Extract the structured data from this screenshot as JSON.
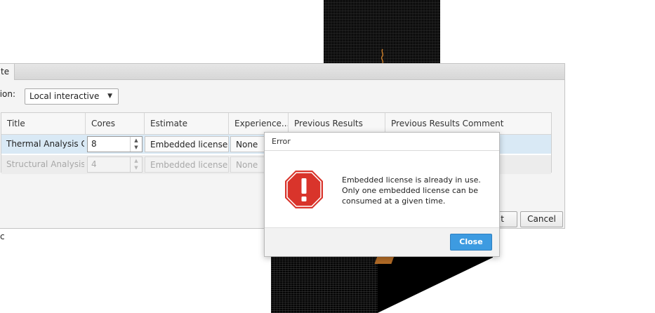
{
  "tab": {
    "label": "te"
  },
  "configuration": {
    "label": "tion:",
    "value": "Local interactive"
  },
  "grid": {
    "columns": [
      "Title",
      "Cores",
      "Estimate",
      "Experience...",
      "Previous Results",
      "Previous Results Comment"
    ],
    "rows": [
      {
        "title": "Thermal Analysis C...",
        "cores": "8",
        "estimate": "Embedded license w...",
        "experience": "None",
        "state": "selected"
      },
      {
        "title": "Structural Analysis ...",
        "cores": "4",
        "estimate": "Embedded license w...",
        "experience": "None",
        "state": "disabled"
      }
    ]
  },
  "buttons": {
    "partial": "t",
    "cancel": "Cancel"
  },
  "stray_text": "c",
  "error_dialog": {
    "title": "Error",
    "icon": "error-stop-icon",
    "message_lines": [
      "Embedded license is already in use.",
      "Only one embedded license can be",
      "consumed at a given time."
    ],
    "close_label": "Close",
    "close_color": "#3d9be1",
    "icon_color": "#d9342b"
  }
}
